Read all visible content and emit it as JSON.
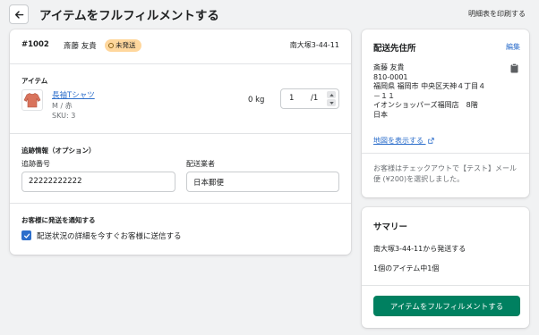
{
  "header": {
    "title": "アイテムをフルフィルメントする",
    "print_label": "明細表を印刷する"
  },
  "order": {
    "number": "#1002",
    "customer": "斎藤 友貴",
    "status": "未発送",
    "location": "南大塚3-44-11"
  },
  "items": {
    "section_label": "アイテム",
    "name": "長袖Tシャツ",
    "variant": "M / 赤",
    "sku": "SKU: 3",
    "weight": "0 kg",
    "quantity": "1",
    "quantity_total": "/1"
  },
  "tracking": {
    "section_label": "追跡情報（オプション）",
    "number_label": "追跡番号",
    "number_value": "22222222222",
    "carrier_label": "配送業者",
    "carrier_value": "日本郵便"
  },
  "notify": {
    "section_label": "お客様に発送を通知する",
    "checkbox_label": "配送状況の詳細を今すぐお客様に送信する",
    "checked": true
  },
  "address": {
    "title": "配送先住所",
    "edit_label": "編集",
    "line1": "斎藤 友貴",
    "line2": "810-0001",
    "line3": "福岡県 福岡市 中央区天神４丁目４",
    "line4": "－１１",
    "line5": "イオンショッパーズ福岡店　8階",
    "line6": "日本",
    "map_link": "地図を表示する",
    "shipping_note": "お客様はチェックアウトで【テスト】メール便 (¥200)を選択しました。"
  },
  "summary": {
    "title": "サマリー",
    "ship_from": "南大塚3-44-11から発送する",
    "item_count": "1個のアイテム中1個",
    "button_label": "アイテムをフルフィルメントする"
  },
  "colors": {
    "primary": "#008060",
    "link": "#2c6ecb",
    "badge": "#ffd79d",
    "background": "#f1f2f3"
  }
}
